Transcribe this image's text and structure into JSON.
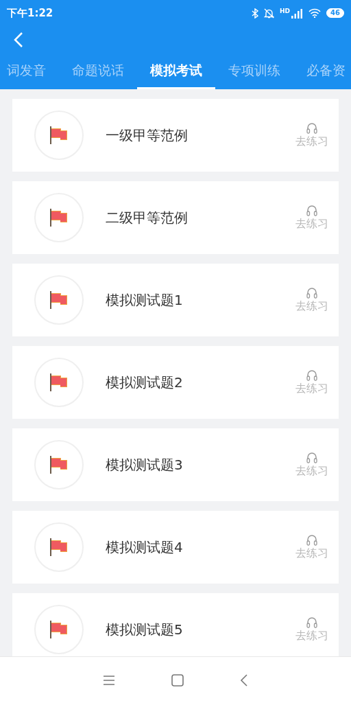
{
  "status_bar": {
    "time": "下午1:22",
    "network_label": "HD",
    "battery": "46"
  },
  "tabs": [
    {
      "label": "词发音",
      "selected": false
    },
    {
      "label": "命题说话",
      "selected": false
    },
    {
      "label": "模拟考试",
      "selected": true
    },
    {
      "label": "专项训练",
      "selected": false
    },
    {
      "label": "必备资",
      "selected": false
    }
  ],
  "items": [
    {
      "title": "一级甲等范例",
      "action": "去练习"
    },
    {
      "title": "二级甲等范例",
      "action": "去练习"
    },
    {
      "title": "模拟测试题1",
      "action": "去练习"
    },
    {
      "title": "模拟测试题2",
      "action": "去练习"
    },
    {
      "title": "模拟测试题3",
      "action": "去练习"
    },
    {
      "title": "模拟测试题4",
      "action": "去练习"
    },
    {
      "title": "模拟测试题5",
      "action": "去练习"
    }
  ]
}
